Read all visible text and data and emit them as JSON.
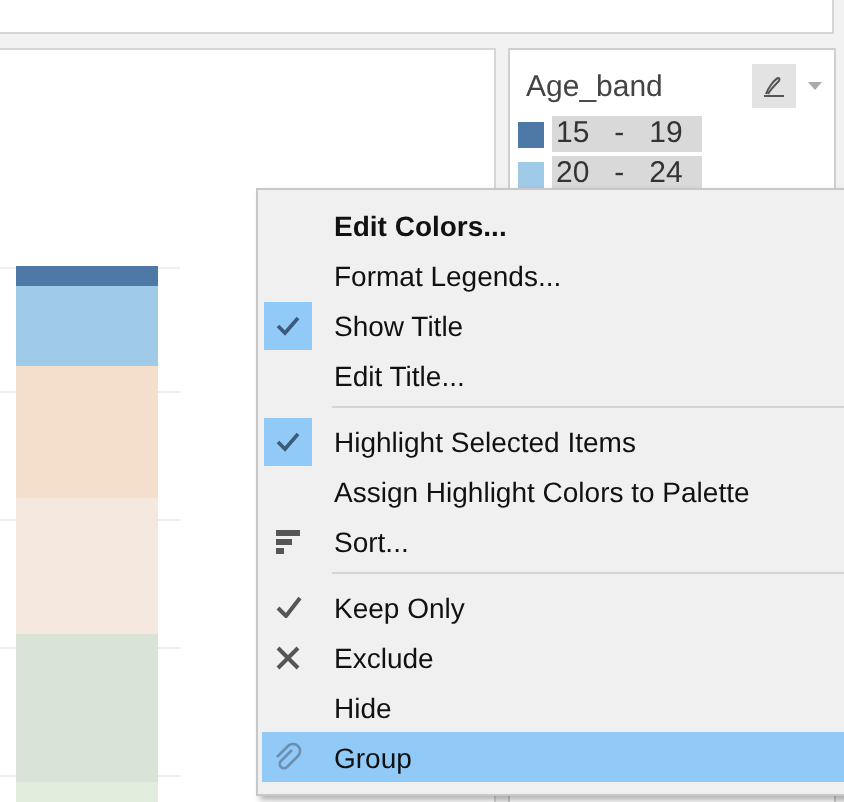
{
  "legend": {
    "title": "Age_band",
    "items": [
      {
        "label": "15   -   19",
        "color": "#4e79a7",
        "selected": true
      },
      {
        "label": "20   -   24",
        "color": "#a0cbe8",
        "selected": true
      }
    ]
  },
  "context_menu": {
    "items": [
      {
        "kind": "item",
        "label": "Edit Colors...",
        "emphasized": true,
        "checked": false,
        "selected": false
      },
      {
        "kind": "item",
        "label": "Format Legends...",
        "emphasized": false,
        "checked": false,
        "selected": false
      },
      {
        "kind": "item",
        "label": "Show Title",
        "emphasized": false,
        "checked": true,
        "selected": false
      },
      {
        "kind": "item",
        "label": "Edit Title...",
        "emphasized": false,
        "checked": false,
        "selected": false
      },
      {
        "kind": "separator"
      },
      {
        "kind": "item",
        "label": "Highlight Selected Items",
        "emphasized": false,
        "checked": true,
        "selected": false
      },
      {
        "kind": "item",
        "label": "Assign Highlight Colors to Palette",
        "emphasized": false,
        "checked": false,
        "selected": false
      },
      {
        "kind": "sort",
        "label": "Sort...",
        "emphasized": false,
        "checked": false,
        "selected": false
      },
      {
        "kind": "separator"
      },
      {
        "kind": "keep",
        "label": "Keep Only",
        "emphasized": false,
        "checked": false,
        "selected": false
      },
      {
        "kind": "exclude",
        "label": "Exclude",
        "emphasized": false,
        "checked": false,
        "selected": false
      },
      {
        "kind": "item",
        "label": "Hide",
        "emphasized": false,
        "checked": false,
        "selected": false
      },
      {
        "kind": "group",
        "label": "Group",
        "emphasized": false,
        "checked": false,
        "selected": true
      }
    ]
  }
}
